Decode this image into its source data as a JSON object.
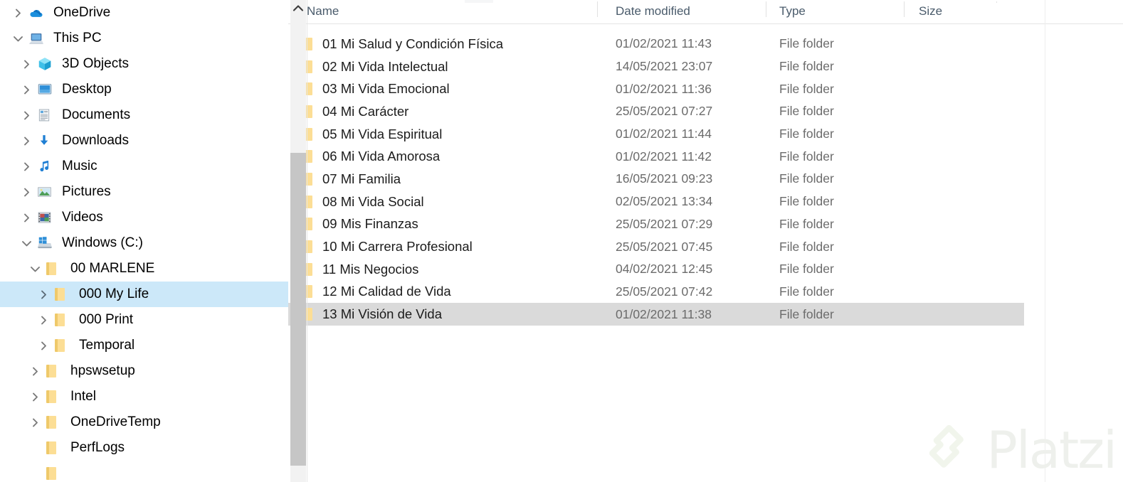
{
  "app": {
    "name": "File Explorer",
    "watermark_text": "Platzi",
    "watermark_color": "#eef0ec"
  },
  "colors": {
    "tree_selection": "#cce8f9",
    "list_selection": "#dadada",
    "folder_yellow": "#f7d88a",
    "header_text": "#4a5b6b",
    "secondary_text": "#6b6b6b"
  },
  "nav_pane": {
    "scroll_up_icon": "chevron-up-icon",
    "items": [
      {
        "label": "OneDrive",
        "level": 0,
        "icon": "onedrive-cloud-icon",
        "twisty": "collapsed",
        "selected": false
      },
      {
        "label": "This PC",
        "level": 0,
        "icon": "this-pc-icon",
        "twisty": "expanded",
        "selected": false
      },
      {
        "label": "3D Objects",
        "level": 1,
        "icon": "3d-objects-icon",
        "twisty": "collapsed",
        "selected": false
      },
      {
        "label": "Desktop",
        "level": 1,
        "icon": "desktop-icon",
        "twisty": "collapsed",
        "selected": false
      },
      {
        "label": "Documents",
        "level": 1,
        "icon": "documents-icon",
        "twisty": "collapsed",
        "selected": false
      },
      {
        "label": "Downloads",
        "level": 1,
        "icon": "downloads-icon",
        "twisty": "collapsed",
        "selected": false
      },
      {
        "label": "Music",
        "level": 1,
        "icon": "music-icon",
        "twisty": "collapsed",
        "selected": false
      },
      {
        "label": "Pictures",
        "level": 1,
        "icon": "pictures-icon",
        "twisty": "collapsed",
        "selected": false
      },
      {
        "label": "Videos",
        "level": 1,
        "icon": "videos-icon",
        "twisty": "collapsed",
        "selected": false
      },
      {
        "label": "Windows  (C:)",
        "level": 1,
        "icon": "local-disk-icon",
        "twisty": "expanded",
        "selected": false
      },
      {
        "label": "00 MARLENE",
        "level": 2,
        "icon": "folder-icon",
        "twisty": "expanded",
        "selected": false
      },
      {
        "label": "000 My Life",
        "level": 3,
        "icon": "folder-icon",
        "twisty": "collapsed",
        "selected": true
      },
      {
        "label": "000 Print",
        "level": 3,
        "icon": "folder-icon",
        "twisty": "collapsed",
        "selected": false
      },
      {
        "label": "Temporal",
        "level": 3,
        "icon": "folder-icon",
        "twisty": "collapsed",
        "selected": false
      },
      {
        "label": "hpswsetup",
        "level": 2,
        "icon": "folder-icon",
        "twisty": "collapsed",
        "selected": false
      },
      {
        "label": "Intel",
        "level": 2,
        "icon": "folder-icon",
        "twisty": "collapsed",
        "selected": false
      },
      {
        "label": "OneDriveTemp",
        "level": 2,
        "icon": "folder-icon",
        "twisty": "collapsed",
        "selected": false
      },
      {
        "label": "PerfLogs",
        "level": 2,
        "icon": "folder-icon",
        "twisty": "none",
        "selected": false
      },
      {
        "label": "",
        "level": 2,
        "icon": "folder-icon",
        "twisty": "none",
        "selected": false
      }
    ]
  },
  "file_list": {
    "columns": [
      {
        "key": "name",
        "label": "Name"
      },
      {
        "key": "date",
        "label": "Date modified"
      },
      {
        "key": "type",
        "label": "Type"
      },
      {
        "key": "size",
        "label": "Size"
      }
    ],
    "rows": [
      {
        "name": "01 Mi Salud y Condición Física",
        "date": "01/02/2021 11:43",
        "type": "File folder",
        "size": "",
        "icon": "folder-icon",
        "selected": false
      },
      {
        "name": "02 Mi Vida Intelectual",
        "date": "14/05/2021 23:07",
        "type": "File folder",
        "size": "",
        "icon": "folder-icon",
        "selected": false
      },
      {
        "name": "03 Mi Vida Emocional",
        "date": "01/02/2021 11:36",
        "type": "File folder",
        "size": "",
        "icon": "folder-icon",
        "selected": false
      },
      {
        "name": "04 Mi Carácter",
        "date": "25/05/2021 07:27",
        "type": "File folder",
        "size": "",
        "icon": "folder-icon",
        "selected": false
      },
      {
        "name": "05 Mi Vida Espiritual",
        "date": "01/02/2021 11:44",
        "type": "File folder",
        "size": "",
        "icon": "folder-icon",
        "selected": false
      },
      {
        "name": "06 Mi Vida Amorosa",
        "date": "01/02/2021 11:42",
        "type": "File folder",
        "size": "",
        "icon": "folder-icon",
        "selected": false
      },
      {
        "name": "07 Mi Familia",
        "date": "16/05/2021 09:23",
        "type": "File folder",
        "size": "",
        "icon": "folder-icon",
        "selected": false
      },
      {
        "name": "08 Mi Vida Social",
        "date": "02/05/2021 13:34",
        "type": "File folder",
        "size": "",
        "icon": "folder-icon",
        "selected": false
      },
      {
        "name": "09 Mis Finanzas",
        "date": "25/05/2021 07:29",
        "type": "File folder",
        "size": "",
        "icon": "folder-icon",
        "selected": false
      },
      {
        "name": "10 Mi Carrera Profesional",
        "date": "25/05/2021 07:45",
        "type": "File folder",
        "size": "",
        "icon": "folder-icon",
        "selected": false
      },
      {
        "name": "11 Mis Negocios",
        "date": "04/02/2021 12:45",
        "type": "File folder",
        "size": "",
        "icon": "folder-icon",
        "selected": false
      },
      {
        "name": "12 Mi Calidad de Vida",
        "date": "25/05/2021 07:42",
        "type": "File folder",
        "size": "",
        "icon": "folder-icon",
        "selected": false
      },
      {
        "name": "13 Mi Visión de Vida",
        "date": "01/02/2021 11:38",
        "type": "File folder",
        "size": "",
        "icon": "folder-icon",
        "selected": true
      }
    ]
  }
}
